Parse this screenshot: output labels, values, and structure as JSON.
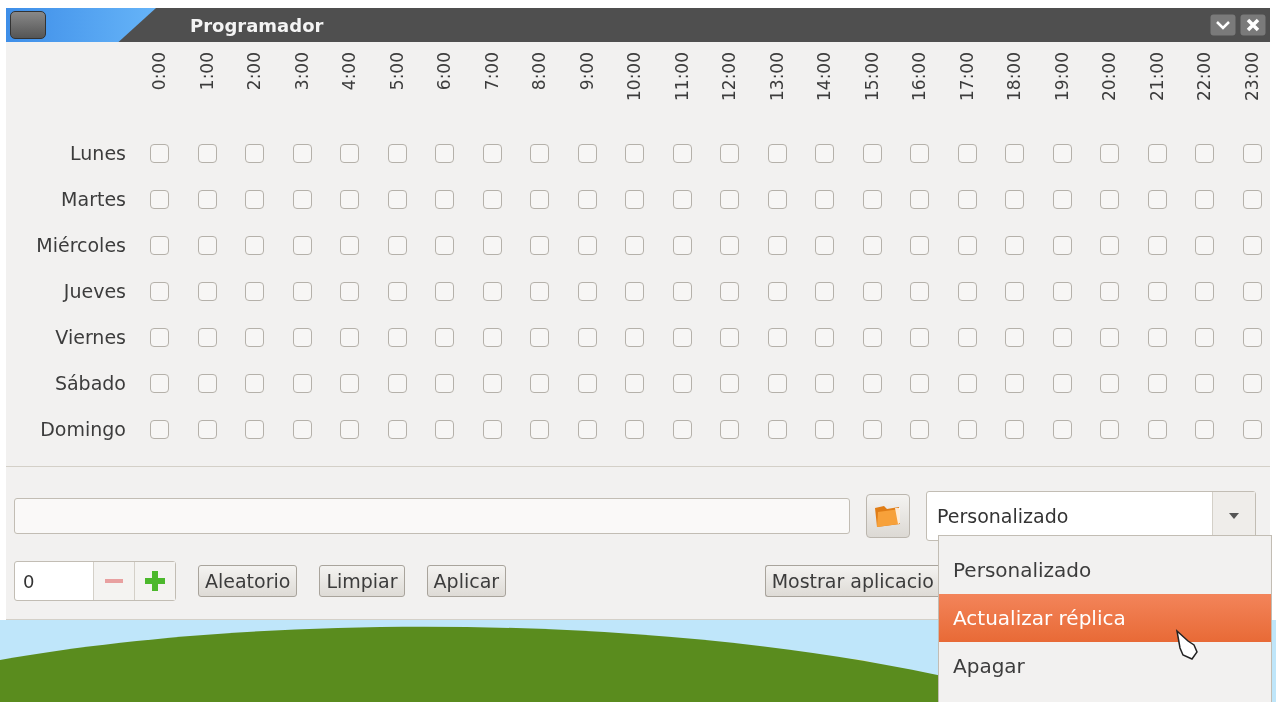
{
  "window": {
    "title": "Programador"
  },
  "hours": [
    "0:00",
    "1:00",
    "2:00",
    "3:00",
    "4:00",
    "5:00",
    "6:00",
    "7:00",
    "8:00",
    "9:00",
    "10:00",
    "11:00",
    "12:00",
    "13:00",
    "14:00",
    "15:00",
    "16:00",
    "17:00",
    "18:00",
    "19:00",
    "20:00",
    "21:00",
    "22:00",
    "23:00"
  ],
  "days": [
    {
      "name": "Lunes",
      "checked": [
        false,
        false,
        false,
        false,
        false,
        false,
        false,
        false,
        false,
        false,
        false,
        false,
        false,
        false,
        false,
        false,
        false,
        false,
        false,
        false,
        false,
        false,
        false,
        false
      ]
    },
    {
      "name": "Martes",
      "checked": [
        false,
        false,
        false,
        false,
        false,
        false,
        false,
        false,
        false,
        false,
        false,
        false,
        false,
        false,
        false,
        false,
        false,
        false,
        false,
        false,
        false,
        false,
        false,
        false
      ]
    },
    {
      "name": "Miércoles",
      "checked": [
        false,
        false,
        false,
        false,
        false,
        false,
        false,
        false,
        false,
        false,
        false,
        false,
        false,
        false,
        false,
        false,
        false,
        false,
        false,
        false,
        false,
        false,
        false,
        false
      ]
    },
    {
      "name": "Jueves",
      "checked": [
        false,
        false,
        false,
        false,
        false,
        false,
        false,
        false,
        false,
        false,
        false,
        false,
        false,
        false,
        false,
        false,
        false,
        false,
        false,
        false,
        false,
        false,
        false,
        false
      ]
    },
    {
      "name": "Viernes",
      "checked": [
        false,
        false,
        false,
        false,
        false,
        false,
        false,
        false,
        false,
        false,
        false,
        false,
        false,
        false,
        false,
        false,
        false,
        false,
        false,
        false,
        false,
        false,
        false,
        false
      ]
    },
    {
      "name": "Sábado",
      "checked": [
        false,
        false,
        false,
        false,
        false,
        false,
        false,
        false,
        false,
        false,
        false,
        false,
        false,
        false,
        false,
        false,
        false,
        false,
        false,
        false,
        false,
        false,
        false,
        false
      ]
    },
    {
      "name": "Domingo",
      "checked": [
        false,
        false,
        false,
        false,
        false,
        false,
        false,
        false,
        false,
        false,
        false,
        false,
        false,
        false,
        false,
        false,
        false,
        false,
        false,
        false,
        false,
        false,
        false,
        false
      ]
    }
  ],
  "spinner": {
    "value": "0"
  },
  "buttons": [
    "Aleatorio",
    "Limpiar",
    "Aplicar"
  ],
  "show_button": "Mostrar aplicacio",
  "combo": {
    "value": "Personalizado",
    "expanded": true
  },
  "combo_options": [
    {
      "label": "Personalizado",
      "selected": false
    },
    {
      "label": "Actualizar réplica",
      "selected": true
    },
    {
      "label": "Apagar",
      "selected": false
    }
  ]
}
